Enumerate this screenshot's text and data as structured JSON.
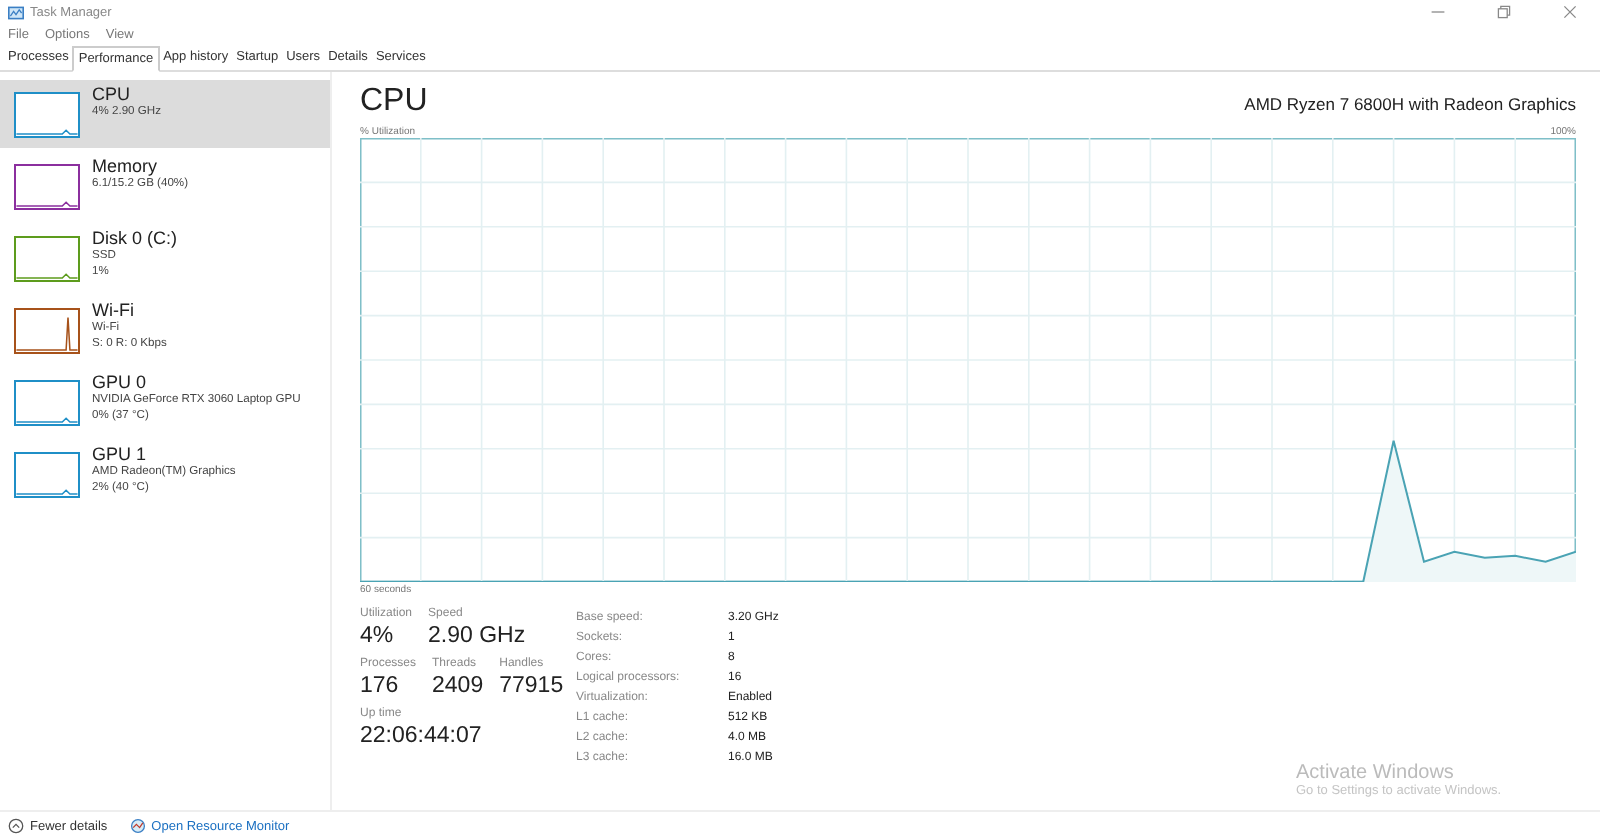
{
  "window": {
    "title": "Task Manager"
  },
  "menu": [
    "File",
    "Options",
    "View"
  ],
  "tabs": [
    {
      "label": "Processes",
      "selected": false
    },
    {
      "label": "Performance",
      "selected": true
    },
    {
      "label": "App history",
      "selected": false
    },
    {
      "label": "Startup",
      "selected": false
    },
    {
      "label": "Users",
      "selected": false
    },
    {
      "label": "Details",
      "selected": false
    },
    {
      "label": "Services",
      "selected": false
    }
  ],
  "sidebar": {
    "items": [
      {
        "title": "CPU",
        "lines": [
          "4% 2.90 GHz"
        ],
        "color": "#1f8fc7",
        "selected": true
      },
      {
        "title": "Memory",
        "lines": [
          "6.1/15.2 GB (40%)"
        ],
        "color": "#8b2f9e",
        "selected": false
      },
      {
        "title": "Disk 0 (C:)",
        "lines": [
          "SSD",
          "1%"
        ],
        "color": "#5d9c1d",
        "selected": false
      },
      {
        "title": "Wi-Fi",
        "lines": [
          "Wi-Fi",
          "S: 0 R: 0 Kbps"
        ],
        "color": "#a7521a",
        "selected": false
      },
      {
        "title": "GPU 0",
        "lines": [
          "NVIDIA GeForce RTX 3060 Laptop GPU",
          "0% (37 °C)"
        ],
        "color": "#1f8fc7",
        "selected": false
      },
      {
        "title": "GPU 1",
        "lines": [
          "AMD Radeon(TM) Graphics",
          "2% (40 °C)"
        ],
        "color": "#1f8fc7",
        "selected": false
      }
    ]
  },
  "panel": {
    "title": "CPU",
    "model": "AMD Ryzen 7 6800H with Radeon Graphics",
    "graph_label": "% Utilization",
    "graph_max": "100%",
    "graph_span": "60 seconds",
    "stats": [
      [
        {
          "label": "Utilization",
          "value": "4%"
        },
        {
          "label": "Speed",
          "value": "2.90 GHz"
        }
      ],
      [
        {
          "label": "Processes",
          "value": "176"
        },
        {
          "label": "Threads",
          "value": "2409"
        },
        {
          "label": "Handles",
          "value": "77915"
        }
      ],
      [
        {
          "label": "Up time",
          "value": "22:06:44:07"
        }
      ]
    ],
    "specs": [
      {
        "label": "Base speed:",
        "value": "3.20 GHz"
      },
      {
        "label": "Sockets:",
        "value": "1"
      },
      {
        "label": "Cores:",
        "value": "8"
      },
      {
        "label": "Logical processors:",
        "value": "16"
      },
      {
        "label": "Virtualization:",
        "value": "Enabled"
      },
      {
        "label": "L1 cache:",
        "value": "512 KB"
      },
      {
        "label": "L2 cache:",
        "value": "4.0 MB"
      },
      {
        "label": "L3 cache:",
        "value": "16.0 MB"
      }
    ]
  },
  "footer": {
    "fewer": "Fewer details",
    "monitor": "Open Resource Monitor"
  },
  "activation": {
    "title": "Activate Windows",
    "subtitle": "Go to Settings to activate Windows."
  }
}
